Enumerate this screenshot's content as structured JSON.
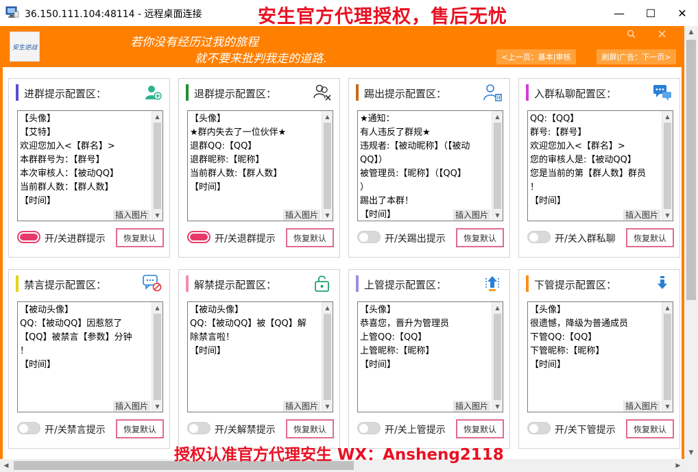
{
  "window": {
    "title": "36.150.111.104:48114 - 远程桌面连接",
    "overlay_text": "安生官方代理授权，售后无忧",
    "minimize": "—",
    "maximize": "☐",
    "close": "✕"
  },
  "app": {
    "logo_text": "安生逆战",
    "motto_line1": "若你没有经历过我的旅程",
    "motto_line2": "就不要来批判我走的道路.",
    "nav_prev": "<上一页：基本|审核",
    "nav_next": "刷屏|广告：下一页>",
    "search_icon": "search-icon",
    "close_icon": "close-icon"
  },
  "cards": [
    {
      "title": "进群提示配置区：",
      "accent": "#5b4fcf",
      "icon": "user-add-icon",
      "lines": [
        "【头像】",
        "【艾特】",
        "欢迎您加入<【群名】>",
        "本群群号为：【群号】",
        "本次审核人：【被动QQ】",
        "当前群人数：【群人数】",
        "【时间】"
      ],
      "toggle_on": true,
      "toggle_label": "开/关进群提示",
      "reset_label": "恢复默认",
      "insert_label": "插入图片"
    },
    {
      "title": "退群提示配置区：",
      "accent": "#1f8f2f",
      "icon": "user-remove-icon",
      "lines": [
        "【头像】",
        "★群内失去了一位伙伴★",
        "退群QQ:【QQ】",
        "退群昵称:【昵称】",
        "当前群人数:【群人数】",
        "【时间】"
      ],
      "toggle_on": true,
      "toggle_label": "开/关退群提示",
      "reset_label": "恢复默认",
      "insert_label": "插入图片"
    },
    {
      "title": "踢出提示配置区：",
      "accent": "#c96a1a",
      "icon": "user-kick-icon",
      "lines": [
        "★通知：",
        "有人违反了群规★",
        "违规者:【被动昵称】（【被动",
        "QQ】）",
        "被管理员:【昵称】（【QQ】",
        "）",
        "踢出了本群！",
        "【时间】"
      ],
      "toggle_on": false,
      "toggle_label": "开/关踢出提示",
      "reset_label": "恢复默认",
      "insert_label": "插入图片"
    },
    {
      "title": "入群私聊配置区：",
      "accent": "#d43ad4",
      "icon": "chat-bubbles-icon",
      "lines": [
        "QQ:【QQ】",
        "群号:【群号】",
        "欢迎您加入<【群名】>",
        "您的审核人是:【被动QQ】",
        "您是当前的第【群人数】群员",
        "！",
        "【时间】"
      ],
      "toggle_on": false,
      "toggle_label": "开/关入群私聊",
      "reset_label": "恢复默认",
      "insert_label": "插入图片"
    },
    {
      "title": "禁言提示配置区：",
      "accent": "#e6d21a",
      "icon": "mute-chat-icon",
      "lines": [
        "【被动头像】",
        "QQ:【被动QQ】因惹怒了",
        "【QQ】被禁言【参数】分钟",
        "！",
        "【时间】"
      ],
      "toggle_on": false,
      "toggle_label": "开/关禁言提示",
      "reset_label": "恢复默认",
      "insert_label": "插入图片"
    },
    {
      "title": "解禁提示配置区：",
      "accent": "#f28fb0",
      "icon": "unlock-icon",
      "lines": [
        "【被动头像】",
        "QQ:【被动QQ】被【QQ】解",
        "除禁言啦！",
        "【时间】"
      ],
      "toggle_on": false,
      "toggle_label": "开/关解禁提示",
      "reset_label": "恢复默认",
      "insert_label": "插入图片"
    },
    {
      "title": "上管提示配置区：",
      "accent": "#9b8fe0",
      "icon": "promote-arrow-icon",
      "lines": [
        "【头像】",
        "恭喜您，晋升为管理员",
        "上管QQ:【QQ】",
        "上管昵称:【昵称】",
        "【时间】"
      ],
      "toggle_on": false,
      "toggle_label": "开/关上管提示",
      "reset_label": "恢复默认",
      "insert_label": "插入图片"
    },
    {
      "title": "下管提示配置区：",
      "accent": "#ff8c1a",
      "icon": "demote-arrow-icon",
      "lines": [
        "【头像】",
        "很遗憾，降级为普通成员",
        "下管QQ:【QQ】",
        "下管昵称:【昵称】",
        "【时间】"
      ],
      "toggle_on": false,
      "toggle_label": "开/关下管提示",
      "reset_label": "恢复默认",
      "insert_label": "插入图片"
    }
  ],
  "bottom_overlay": "授权认准官方代理安生 WX：Ansheng2118"
}
